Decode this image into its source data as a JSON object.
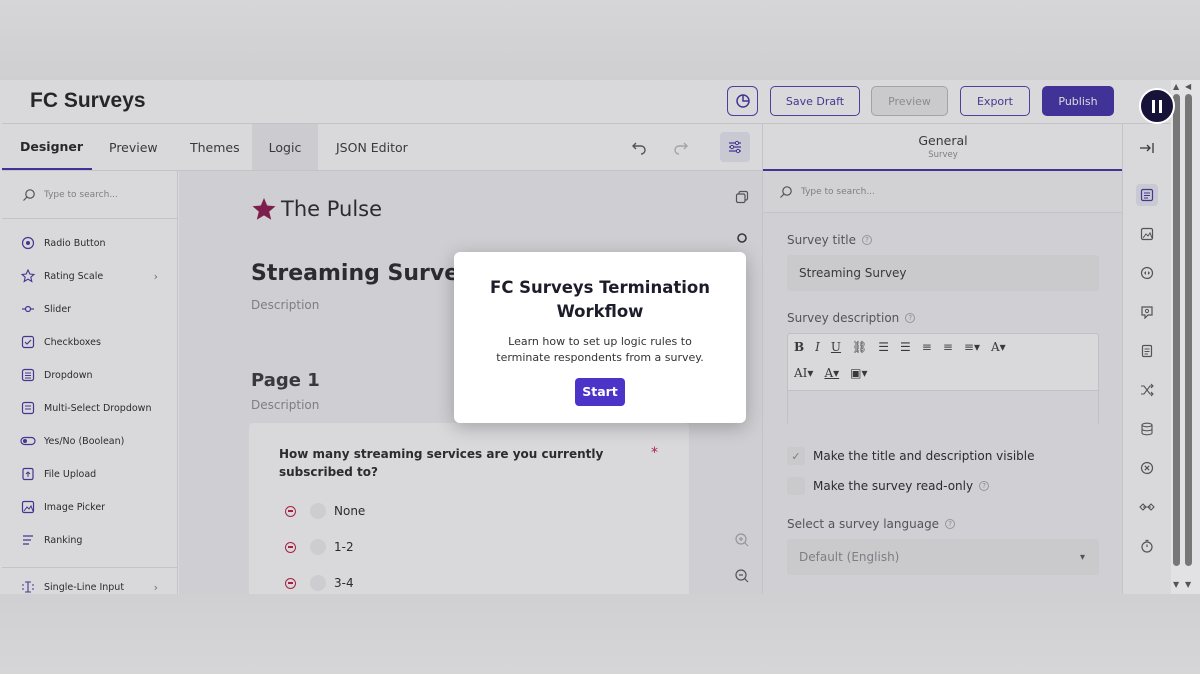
{
  "header": {
    "brand": "FC Surveys",
    "save_draft": "Save Draft",
    "preview": "Preview",
    "export": "Export",
    "publish": "Publish"
  },
  "tabs": [
    {
      "label": "Designer"
    },
    {
      "label": "Preview"
    },
    {
      "label": "Themes"
    },
    {
      "label": "Logic"
    },
    {
      "label": "JSON Editor"
    }
  ],
  "toolbox": {
    "search_placeholder": "Type to search...",
    "items": [
      {
        "label": "Radio Button",
        "icon": "radio-icon"
      },
      {
        "label": "Rating Scale",
        "icon": "rating-icon"
      },
      {
        "label": "Slider",
        "icon": "slider-icon"
      },
      {
        "label": "Checkboxes",
        "icon": "checkbox-icon"
      },
      {
        "label": "Dropdown",
        "icon": "dropdown-icon"
      },
      {
        "label": "Multi-Select Dropdown",
        "icon": "multi-dropdown-icon"
      },
      {
        "label": "Yes/No (Boolean)",
        "icon": "toggle-icon"
      },
      {
        "label": "File Upload",
        "icon": "file-upload-icon"
      },
      {
        "label": "Image Picker",
        "icon": "image-picker-icon"
      },
      {
        "label": "Ranking",
        "icon": "ranking-icon"
      },
      {
        "label": "Single-Line Input",
        "icon": "text-input-icon"
      }
    ]
  },
  "survey": {
    "logo_text": "The Pulse",
    "title": "Streaming Survey",
    "description": "Description",
    "page_title": "Page 1",
    "page_description": "Description",
    "question": "How many streaming services are you currently subscribed to?",
    "required_mark": "*",
    "options": [
      "None",
      "1-2",
      "3-4"
    ]
  },
  "properties": {
    "title": "General",
    "subtitle": "Survey",
    "search_placeholder": "Type to search...",
    "survey_title_label": "Survey title",
    "survey_title_value": "Streaming Survey",
    "survey_description_label": "Survey description",
    "visible_checkbox": "Make the title and description visible",
    "readonly_checkbox": "Make the survey read-only",
    "language_label": "Select a survey language",
    "language_value": "Default (English)"
  },
  "modal": {
    "title": "FC Surveys Termination Workflow",
    "text": "Learn how to set up logic rules to terminate respondents from a survey.",
    "button": "Start"
  },
  "colors": {
    "accent": "#3d2aa8",
    "required": "#c0143c",
    "logo_star": "#8a1048"
  }
}
